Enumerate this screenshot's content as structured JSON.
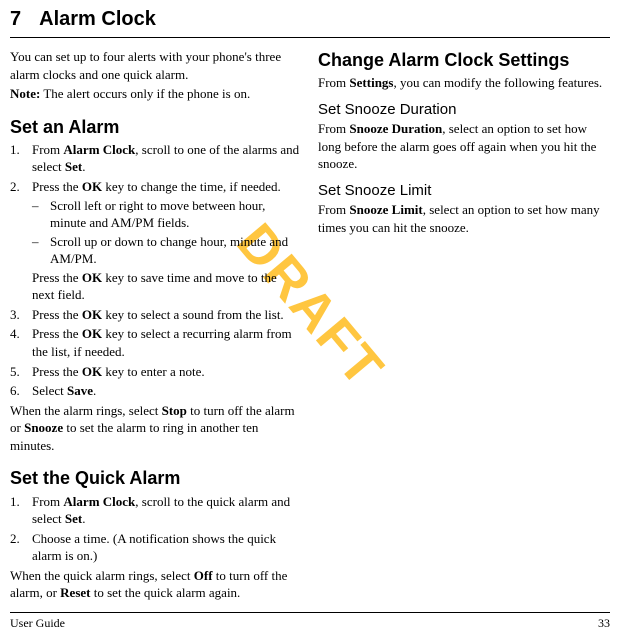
{
  "chapter": {
    "number": "7",
    "title": "Alarm Clock"
  },
  "watermark": "DRAFT",
  "footer": {
    "left": "User Guide",
    "right": "33"
  },
  "intro": {
    "p1a": "You can set up to four alerts with your phone's three alarm clocks and one quick alarm.",
    "note_label": "Note:",
    "note_text": " The alert occurs only if the phone is on."
  },
  "set_alarm": {
    "heading": "Set an Alarm",
    "s1a": "From ",
    "s1b": "Alarm Clock",
    "s1c": ", scroll to one of the alarms and select ",
    "s1d": "Set",
    "s1e": ".",
    "s2a": "Press the ",
    "s2b": "OK",
    "s2c": " key to change the time, if needed.",
    "d1": "Scroll left or right to move between hour, minute and AM/PM fields.",
    "d2": "Scroll up or down to change hour, minute and AM/PM.",
    "s2post_a": "Press the ",
    "s2post_b": "OK",
    "s2post_c": " key to save time and move to the next field.",
    "s3a": "Press the ",
    "s3b": "OK",
    "s3c": " key to select a sound from the list.",
    "s4a": "Press the ",
    "s4b": "OK",
    "s4c": " key to select a recurring alarm from the list, if needed.",
    "s5a": "Press the ",
    "s5b": "OK",
    "s5c": " key to enter a note.",
    "s6a": "Select ",
    "s6b": "Save",
    "s6c": ".",
    "after_a": "When the alarm rings, select ",
    "after_b": "Stop",
    "after_c": " to turn off the alarm or ",
    "after_d": "Snooze",
    "after_e": " to set the alarm to ring in another ten minutes."
  },
  "quick_alarm": {
    "heading": "Set the Quick Alarm",
    "s1a": "From ",
    "s1b": "Alarm Clock",
    "s1c": ", scroll to the quick alarm and select ",
    "s1d": "Set",
    "s1e": ".",
    "s2": "Choose a time. (A notification shows the quick alarm is on.)",
    "after_a": "When the quick alarm rings, select ",
    "after_b": "Off",
    "after_c": " to turn off the alarm, or ",
    "after_d": "Reset",
    "after_e": " to set the quick alarm again."
  },
  "change_settings": {
    "heading": "Change Alarm Clock Settings",
    "p_a": "From ",
    "p_b": "Settings",
    "p_c": ", you can modify the following features.",
    "snooze_dur_h": "Set Snooze Duration",
    "sd_a": "From ",
    "sd_b": "Snooze Duration",
    "sd_c": ", select an option to set how long before the alarm goes off again when you hit the snooze.",
    "snooze_lim_h": "Set Snooze Limit",
    "sl_a": "From ",
    "sl_b": "Snooze Limit",
    "sl_c": ", select an option to set how many times you can hit the snooze."
  }
}
